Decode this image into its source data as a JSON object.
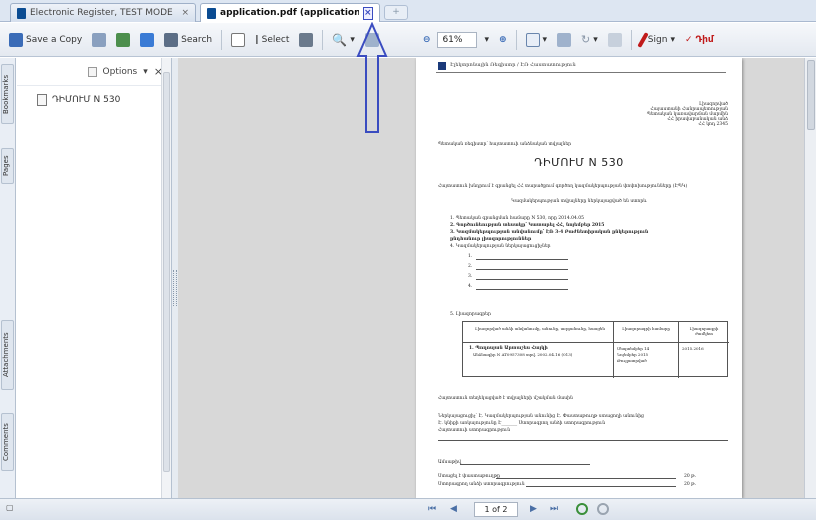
{
  "tabs": [
    {
      "label": "Electronic Register, TEST MODE",
      "active": false
    },
    {
      "label": "application.pdf (application/pdf O...",
      "active": true
    }
  ],
  "toolbar": {
    "save_copy": "Save a Copy",
    "search": "Search",
    "select": "Select",
    "zoom": "61%",
    "sign": "Sign",
    "red_label": "Դիմ"
  },
  "panel": {
    "options": "Options",
    "close": "×",
    "bookmark": "ԴԻՄՈՒՄ N 530"
  },
  "vtabs": [
    "Bookmarks",
    "Pages",
    "Attachments",
    "Comments"
  ],
  "page": {
    "header_org": "Էլեկտրոնային Ռեգիստր / ԷՌ Հաստատություն",
    "right_block": [
      "Լիազորված",
      "Հայաստանի Հանրապետության",
      "Պետական կառավարման մարմին",
      "ՀՀ իրավաբանական անձ",
      "ՀՀ կոդ 2345"
    ],
    "intro": "Պետական ռեգիստր՝ հայտատուի անձնական տվյալներ",
    "title": "ԴԻՄՈՒՄ N 530",
    "para1": "Հայտատուն խնդրում է գրանցել ՀՀ տարածքում գործող կազմակերպության փոփոխությունները (ԷՊԿ)",
    "para2": "Կազմակերպության տվյալները ներկայացված են ստորև",
    "items": [
      "1. Պետական գրանցման համարը N 530, որը 2014.04.05",
      "2. Գործունեության տեսակը՝ Կատարել ՀՀ, նոյեմբեր 2015",
      "3. Կազմակերպության անվանումը՝ ԷՌ 3-4 Բաժնետիրական ընկերություն",
      "   ընդհանուր լիազորություններ",
      "4. Կազմակերպության ներկայացուցիչներ"
    ],
    "sublist": [
      "1.",
      "2.",
      "3.",
      "4."
    ],
    "section5": "5. Լիազորագրեր",
    "tbl_head": [
      "Լիազորված անձի անվանումը, անունը, ազգանունը, հասցեն",
      "Լիազորագրի համարը",
      "Լիազորագրի ժամկետ"
    ],
    "tbl_row": [
      "1. Պողոսյան Արտաշես Հայկի",
      "Անձնագիր N AT0957308 տրվ. 2002.04.16 (013)",
      "Սեպտեմբեր 14",
      "Նոյեմբեր 2015",
      "Թույլատրված",
      "2015.2016"
    ],
    "note": "Հայտատուն տեղեկացված է տվյալների մշակման մասին",
    "sig_line": "Ներկայացուցիչ՝ Է. Կազմակերպության անունից  Է. Փաստաթուղթ ստացողի անունից",
    "sig2": "Է. կնիքի առկայությունը Է_______ Ստորագրող անձի ստորագրություն",
    "sig3": "Հայտատուի ստորագրություն",
    "bottom1": "Ամսաթիվ",
    "bottom2": "Ստացել է փաստաթուղթը",
    "bottom3": "Ստորագրող անձի ստորագրություն",
    "bottom_date": "20   թ.",
    "bottom_date2": "20   թ."
  },
  "status": {
    "page_label": "1 of 2",
    "first": "⏮",
    "prev": "◀",
    "next": "▶",
    "last": "⏭"
  },
  "colors": {
    "tab_border_active": "#3a4cc0",
    "sign_red": "#c01a1a",
    "arrow": "#3a4cc0",
    "toolbar_bg": "#e4e9f0"
  }
}
